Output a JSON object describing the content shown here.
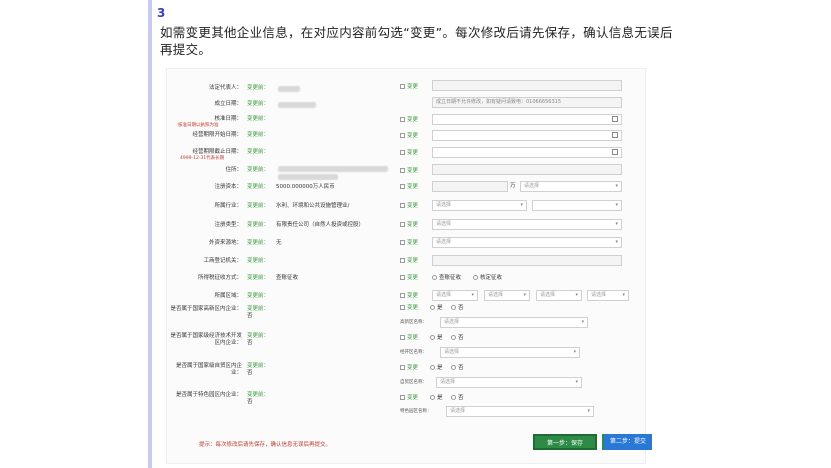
{
  "step": {
    "number": "3",
    "instruction": "如需变更其他企业信息，在对应内容前勾选“变更”。每次修改后请先保存，确认信息无误后再提交。"
  },
  "form": {
    "rows": [
      {
        "label": "法定代表人：",
        "prior": "变更前：",
        "check": "变更"
      },
      {
        "label": "成立日期：",
        "prior": "变更前：",
        "note": "成立日期不允许修改，如有疑问请致电：01066656315"
      },
      {
        "label": "核准日期：",
        "sublabel": "核准日期以执照为准",
        "prior": "变更前：",
        "check": "变更"
      },
      {
        "label": "经营期限开始日期：",
        "prior": "变更前：",
        "check": "变更"
      },
      {
        "label": "经营期限截止日期：",
        "sublabel": "4999-12-31代表长期",
        "prior": "变更前：",
        "check": "变更"
      },
      {
        "label": "住所：",
        "prior": "变更前：",
        "check": "变更"
      },
      {
        "label": "注册资本：",
        "prior": "变更前：",
        "value": "5000.000000万人民币",
        "check": "变更",
        "unit": "万",
        "select": "请选择"
      },
      {
        "label": "所属行业：",
        "prior": "变更前：",
        "value": "水利、环境和公共设施管理业/",
        "check": "变更",
        "select": "请选择"
      },
      {
        "label": "注册类型：",
        "prior": "变更前：",
        "value": "有限责任公司（自然人投资或控股）",
        "check": "变更",
        "select": "请选择"
      },
      {
        "label": "外资来源地：",
        "prior": "变更前：",
        "value": "无",
        "check": "变更",
        "select": "请选择"
      },
      {
        "label": "工商登记机关：",
        "prior": "变更前：",
        "check": "变更"
      },
      {
        "label": "所得税征收方式：",
        "prior": "变更前：",
        "value": "查账征收",
        "check": "变更",
        "options": [
          "查账征收",
          "核定征收"
        ]
      },
      {
        "label": "所属区域：",
        "prior": "变更前：",
        "check": "变更",
        "selects": [
          "请选择",
          "请选择",
          "请选择",
          "请选择"
        ]
      },
      {
        "label": "是否属于国家高新区内企业：",
        "prior": "变更前：",
        "value": "否",
        "check": "变更",
        "yes": "是",
        "no": "否",
        "sub": "高新区名称：",
        "select": "请选择"
      },
      {
        "label": "是否属于国家级经济技术开发区内企业：",
        "prior": "变更前：",
        "value": "否",
        "check": "变更",
        "yes": "是",
        "no": "否",
        "sub": "经开区名称：",
        "select": "请选择"
      },
      {
        "label": "是否属于国家级自贸区内企业：",
        "prior": "变更前：",
        "value": "否",
        "check": "变更",
        "yes": "是",
        "no": "否",
        "sub": "自贸区名称：",
        "select": "请选择"
      },
      {
        "label": "是否属于特色园区内企业：",
        "prior": "变更前：",
        "value": "否",
        "check": "变更",
        "yes": "是",
        "no": "否",
        "sub": "特色园区名称：",
        "select": "请选择"
      }
    ]
  },
  "footer": {
    "tip": "提示：每次修改后请先保存，确认信息无误后再提交。",
    "save_button": "第一步：保存",
    "submit_button": "第二步：提交"
  },
  "colors": {
    "accent": "#3a3fb8",
    "green": "#2e8b46",
    "blue": "#2a78d6",
    "warn": "#c0392b"
  }
}
